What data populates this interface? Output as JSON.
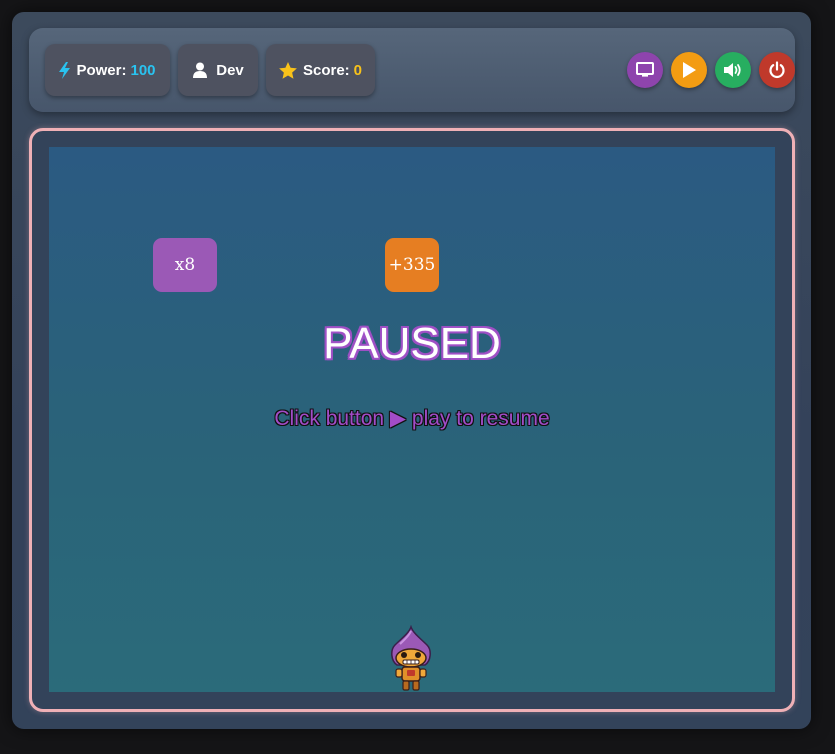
{
  "topbar": {
    "power": {
      "label": "Power:",
      "value": "100",
      "icon": "lightning-bolt-icon"
    },
    "user": {
      "label": "Dev",
      "icon": "user-icon"
    },
    "score": {
      "label": "Score:",
      "value": "0",
      "icon": "star-icon"
    },
    "controls": [
      {
        "name": "screen",
        "icon": "monitor-icon",
        "color": "#8e44ad"
      },
      {
        "name": "play",
        "icon": "play-icon",
        "color": "#f39c12"
      },
      {
        "name": "sound",
        "icon": "volume-icon",
        "color": "#27ae60"
      },
      {
        "name": "power",
        "icon": "power-icon",
        "color": "#c0392b"
      }
    ]
  },
  "game": {
    "tiles": [
      {
        "text": "x8",
        "color": "#9b59b6"
      },
      {
        "text": "+335",
        "color": "#e67e22"
      }
    ],
    "paused_title": "PAUSED",
    "resume_hint": "Click button ▶ play to resume",
    "frame_color": "#efb0b6"
  }
}
